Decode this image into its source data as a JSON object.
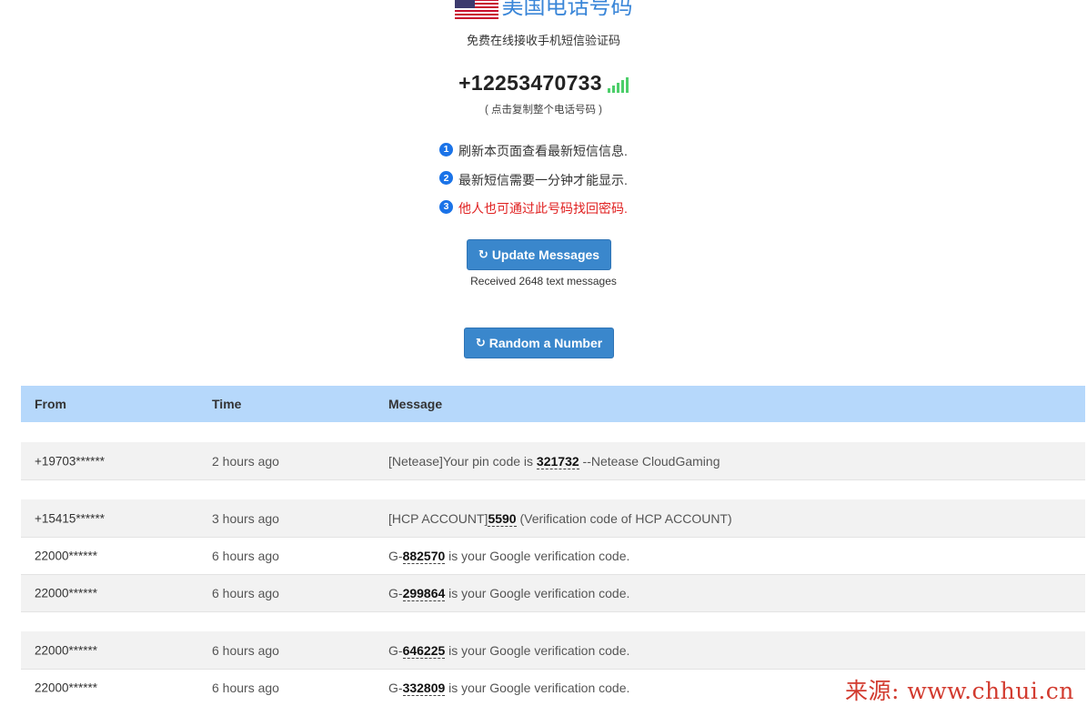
{
  "header": {
    "title": "美国电话号码",
    "subtitle": "免费在线接收手机短信验证码",
    "phone_number": "+12253470733",
    "copy_hint": "( 点击复制整个电话号码 )"
  },
  "tips": [
    {
      "num": "1",
      "text": "刷新本页面查看最新短信信息."
    },
    {
      "num": "2",
      "text": "最新短信需要一分钟才能显示."
    },
    {
      "num": "3",
      "text": "他人也可通过此号码找回密码."
    }
  ],
  "actions": {
    "update_label": "Update Messages",
    "received_text": "Received 2648 text messages",
    "random_label": "Random a Number",
    "refresh_icon": "↻"
  },
  "table": {
    "headers": {
      "from": "From",
      "time": "Time",
      "message": "Message"
    },
    "rows": [
      {
        "from": "+19703******",
        "time": "2 hours ago",
        "pre": "[Netease]Your pin code is ",
        "code": "321732",
        "post": " --Netease CloudGaming"
      },
      {
        "from": "+15415******",
        "time": "3 hours ago",
        "pre": "[HCP ACCOUNT]",
        "code": "5590",
        "post": " (Verification code of HCP ACCOUNT)"
      },
      {
        "from": "22000******",
        "time": "6 hours ago",
        "pre": "G-",
        "code": "882570",
        "post": " is your Google verification code."
      },
      {
        "from": "22000******",
        "time": "6 hours ago",
        "pre": "G-",
        "code": "299864",
        "post": " is your Google verification code."
      },
      {
        "from": "22000******",
        "time": "6 hours ago",
        "pre": "G-",
        "code": "646225",
        "post": " is your Google verification code."
      },
      {
        "from": "22000******",
        "time": "6 hours ago",
        "pre": "G-",
        "code": "332809",
        "post": " is your Google verification code."
      }
    ]
  },
  "watermark": "来源: www.chhui.cn",
  "colors": {
    "accent": "#3a87cc",
    "header_bg": "#b6d8fb",
    "warn": "#e02020",
    "signal": "#4cce6a"
  }
}
